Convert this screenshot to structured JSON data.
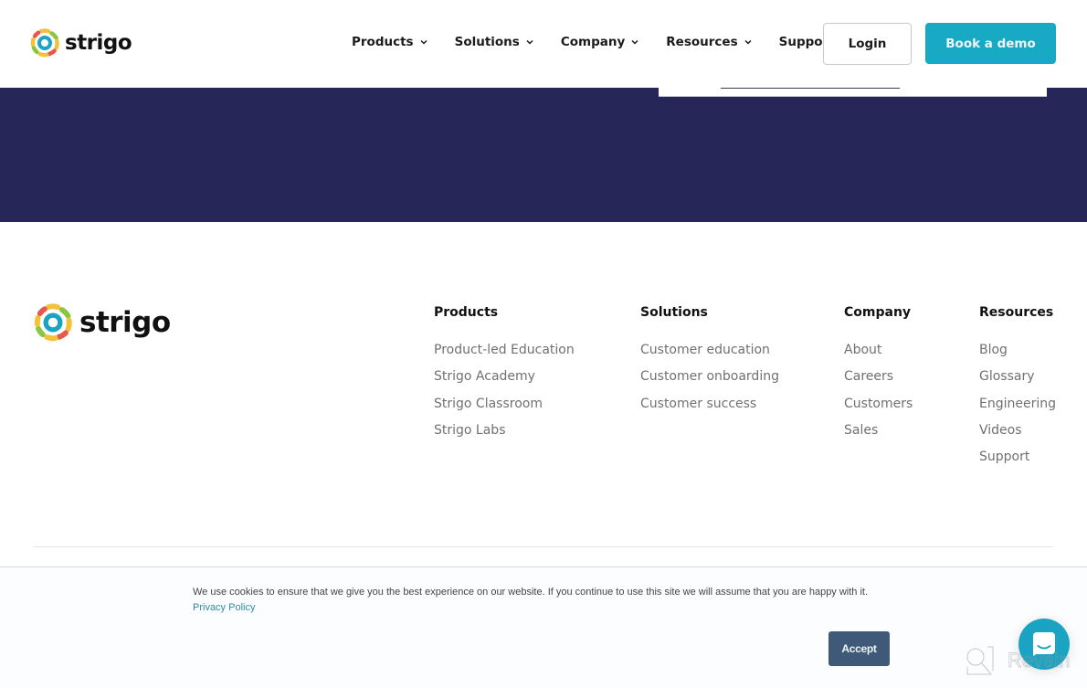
{
  "header": {
    "logo_text": "strigo",
    "nav": [
      {
        "label": "Products",
        "has_dropdown": true
      },
      {
        "label": "Solutions",
        "has_dropdown": true
      },
      {
        "label": "Company",
        "has_dropdown": true
      },
      {
        "label": "Resources",
        "has_dropdown": true
      },
      {
        "label": "Support",
        "has_dropdown": false
      }
    ],
    "login_label": "Login",
    "demo_label": "Book a demo"
  },
  "colors": {
    "brand_teal": "#18a9c4",
    "hero_navy": "#272659",
    "accept_button": "#3f5a78",
    "link_color": "#2f8aa8"
  },
  "footer": {
    "logo_text": "strigo",
    "columns": [
      {
        "title": "Products",
        "links": [
          "Product-led Education",
          "Strigo Academy",
          "Strigo Classroom",
          "Strigo Labs"
        ]
      },
      {
        "title": "Solutions",
        "links": [
          "Customer education",
          "Customer onboarding",
          "Customer success"
        ]
      },
      {
        "title": "Company",
        "links": [
          "About",
          "Careers",
          "Customers",
          "Sales"
        ]
      },
      {
        "title": "Resources",
        "links": [
          "Blog",
          "Glossary",
          "Engineering",
          "Videos",
          "Support"
        ]
      }
    ]
  },
  "cookie": {
    "message": "We use cookies to ensure that we give you the best experience on our website. If you continue to use this site we will assume that you are happy with it.",
    "privacy_label": "Privacy Policy",
    "accept_label": "Accept"
  },
  "chat": {
    "icon": "chat-icon"
  },
  "watermark": {
    "text": "Revain"
  }
}
